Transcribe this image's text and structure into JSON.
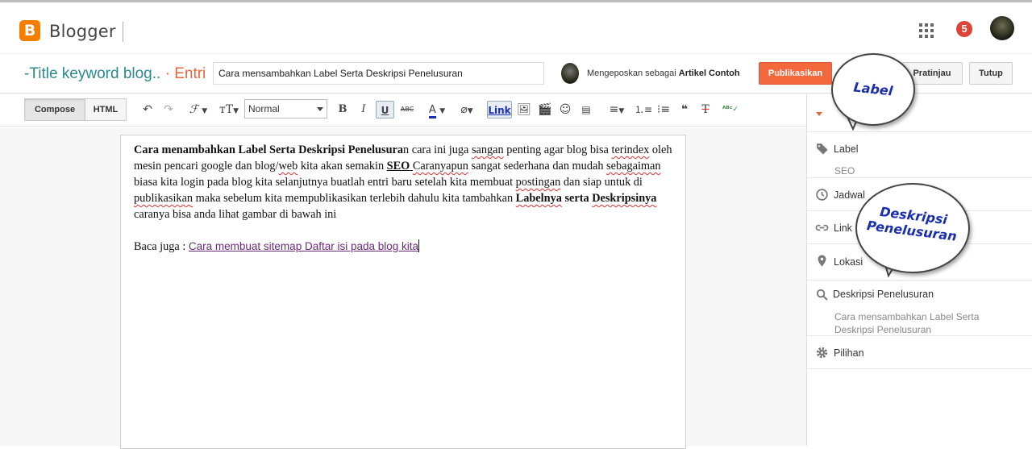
{
  "header": {
    "logo_letter": "B",
    "brand": "Blogger",
    "notification_count": "5"
  },
  "titlebar": {
    "blog_title": "-Title keyword blog..",
    "separator": " · ",
    "entry_label": "Entri",
    "post_title_value": "Cara mensambahkan Label Serta Deskripsi Penelusuran",
    "posting_as_prefix": "Mengeposkan sebagai",
    "posting_as_name": "Artikel Contoh",
    "publish_label": "Publikasikan",
    "preview_label": "Pratinjau",
    "close_label": "Tutup"
  },
  "toolbar": {
    "compose_label": "Compose",
    "html_label": "HTML",
    "format_select": "Normal",
    "link_label": "Link"
  },
  "editor": {
    "p1_bold": "Cara menambahkan Label Serta Deskripsi Penelusura",
    "p1_a": "n cara ini juga ",
    "p1_w1": "sangan",
    "p1_b": " penting agar blog bisa ",
    "p1_w2": "terindex",
    "p1_c": " oleh mesin pencari google dan blog/",
    "p1_w3": "web",
    "p1_d": " kita akan semakin ",
    "p1_seo": "SEO",
    "p1_e": " ",
    "p1_w4": "Caranyapun",
    "p1_f": " sangat sederhana dan mudah ",
    "p1_w5": "sebagaiman",
    "p1_g": " biasa kita login pada blog kita selanjutnya buatlah entri baru setelah kita membuat ",
    "p1_w6": "postingan",
    "p1_h": " dan siap untuk di ",
    "p1_w7": "publikasikan",
    "p1_i": " maka sebelum kita mempublikasikan terlebih dahulu kita tambahkan ",
    "p1_bold2a": "Labelnya",
    "p1_bold2b": " serta ",
    "p1_bold2c": "Deskripsinya",
    "p1_j": " caranya bisa anda lihat gambar di bawah ini",
    "read_also_prefix": "Baca juga : ",
    "read_also_link": "Cara membuat sitemap Daftar isi pada blog kita"
  },
  "sidebar": {
    "label_title": "Label",
    "label_value": "SEO",
    "schedule_title": "Jadwal",
    "links_title": "Link",
    "location_title": "Lokasi",
    "search_desc_title": "Deskripsi Penelusuran",
    "search_desc_value": "Cara mensambahkan Label Serta Deskripsi Penelusuran",
    "options_title": "Pilihan"
  },
  "annotations": {
    "label_bubble": "Label",
    "desc_bubble": "Deskripsi Penelusuran"
  },
  "colors": {
    "brand_orange": "#f57d00",
    "publish_orange": "#f4683e",
    "blog_title_teal": "#2a8a8e",
    "bubble_text_blue": "#1a2fb0"
  }
}
